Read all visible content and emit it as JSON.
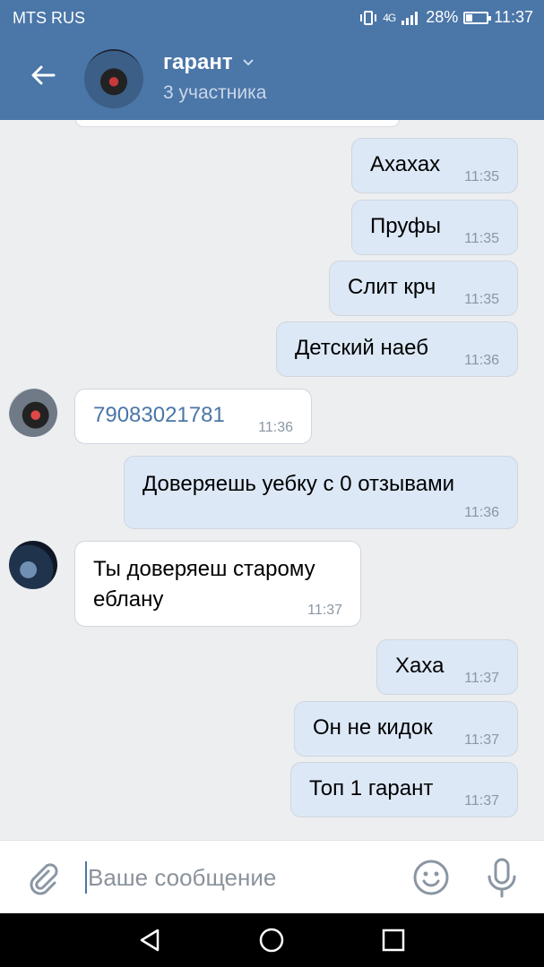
{
  "status_bar": {
    "carrier": "MTS RUS",
    "network": "4G",
    "battery": "28%",
    "battery_level": 0.28,
    "time": "11:37"
  },
  "header": {
    "title": "гарант",
    "subtitle": "3 участника",
    "icons": [
      "back-arrow-icon",
      "chevron-down-icon"
    ]
  },
  "messages": [
    {
      "dir": "out",
      "text": "Ахахах",
      "time": "11:35"
    },
    {
      "dir": "out",
      "text": "Пруфы",
      "time": "11:35"
    },
    {
      "dir": "out",
      "text": "Слит крч",
      "time": "11:35"
    },
    {
      "dir": "out",
      "text": "Детский наеб",
      "time": "11:36"
    },
    {
      "dir": "in",
      "text": "79083021781",
      "time": "11:36",
      "is_link": true
    },
    {
      "dir": "out",
      "text": "Доверяешь уебку с 0 отзывами",
      "time": "11:36"
    },
    {
      "dir": "in",
      "text": "Ты доверяеш старому еблану",
      "time": "11:37"
    },
    {
      "dir": "out",
      "text": "Хаха",
      "time": "11:37"
    },
    {
      "dir": "out",
      "text": "Он не кидок",
      "time": "11:37"
    },
    {
      "dir": "out",
      "text": "Топ 1 гарант",
      "time": "11:37"
    }
  ],
  "composer": {
    "placeholder": "Ваше сообщение",
    "value": "",
    "icons": [
      "paperclip-icon",
      "emoji-icon",
      "microphone-icon"
    ]
  },
  "nav_bar": {
    "icons": [
      "back-triangle-icon",
      "home-circle-icon",
      "recents-square-icon"
    ]
  },
  "colors": {
    "header": "#4a76a8",
    "outgoing_bubble": "#dce8f6",
    "incoming_bubble": "#ffffff",
    "background": "#edeef0",
    "link": "#4a76a8"
  }
}
